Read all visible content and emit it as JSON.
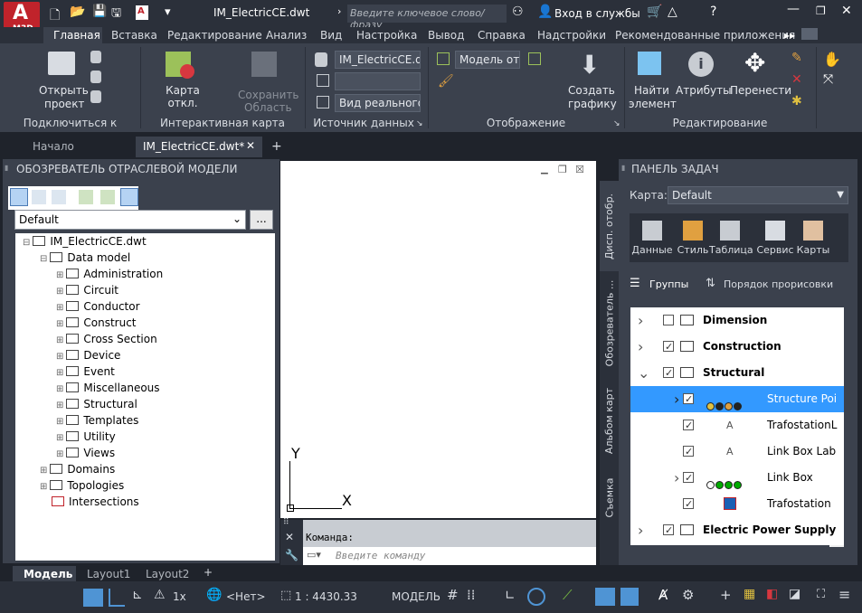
{
  "app": {
    "logo": "А",
    "logo_sub": "M3D",
    "title": "IM_ElectricCE.dwt",
    "search_placeholder": "Введите ключевое слово/фразу",
    "login": "Вход в службы"
  },
  "ribbon_tabs": [
    "Главная",
    "Вставка",
    "Редактирование",
    "Анализ",
    "Вид",
    "Настройка",
    "Вывод",
    "Справка",
    "Надстройки",
    "Рекомендованные приложения"
  ],
  "ribbon": {
    "connect": {
      "open": "Открыть",
      "open2": "проект",
      "title": "Подключиться к данным"
    },
    "map": {
      "btn": "Карта откл.",
      "save": "Сохранить",
      "save2": "Область",
      "title": "Интерактивная карта"
    },
    "source": {
      "file": "IM_ElectricCE.dwt",
      "view": "Вид реального",
      "title": "Источник данных"
    },
    "display": {
      "model": "Модель от",
      "create": "Создать",
      "create2": "графику",
      "title": "Отображение"
    },
    "edit": {
      "find": "Найти",
      "find2": "элемент",
      "attrs": "Атрибуты",
      "move": "Перенести",
      "title": "Редактирование"
    }
  },
  "doc_tabs": [
    "Начало",
    "IM_ElectricCE.dwt*"
  ],
  "left_panel": {
    "title": "ОБОЗРЕВАТЕЛЬ ОТРАСЛЕВОЙ МОДЕЛИ",
    "combo": "Default",
    "more": "...",
    "root": "IM_ElectricCE.dwt",
    "datamodel": "Data model",
    "items": [
      "Administration",
      "Circuit",
      "Conductor",
      "Construct",
      "Cross Section",
      "Device",
      "Event",
      "Miscellaneous",
      "Structural",
      "Templates",
      "Utility",
      "Views"
    ],
    "domains": "Domains",
    "topologies": "Topologies",
    "intersections": "Intersections"
  },
  "command": {
    "label": "Команда:",
    "placeholder": "Введите команду"
  },
  "axis": {
    "y": "Y",
    "x": "X"
  },
  "right_panel": {
    "title": "ПАНЕЛЬ ЗАДАЧ",
    "map_label": "Карта:",
    "map_value": "Default",
    "tools": [
      "Данные",
      "Стиль",
      "Таблица",
      "Сервис",
      "Карты"
    ],
    "groups": "Группы",
    "order": "Порядок прорисовки",
    "vtabs": [
      "Дисп. отобр.",
      "Обозреватель ...",
      "Альбом карт",
      "Съемка"
    ],
    "layers": [
      "Dimension",
      "Construction",
      "Structural",
      "Structure Poi",
      "TrafostationL",
      "Link Box Lab",
      "Link Box",
      "Trafostation",
      "Electric Power Supply"
    ]
  },
  "layout_tabs": [
    "Модель",
    "Layout1",
    "Layout2"
  ],
  "status": {
    "scale": "1x",
    "coord": "<Нет>",
    "ratio": "1 : 4430.33",
    "model": "МОДЕЛЬ"
  }
}
